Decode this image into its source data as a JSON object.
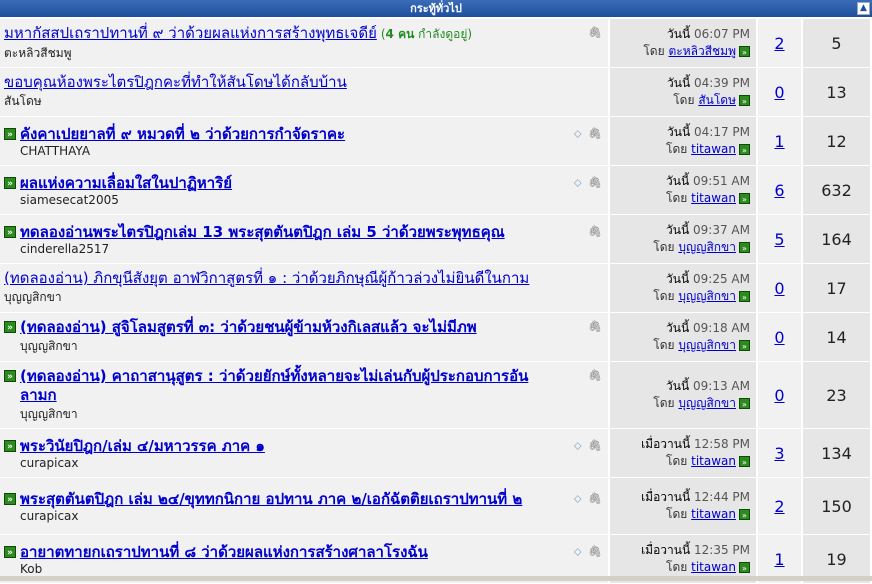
{
  "forum": {
    "header": "กระทู้ทั่วไป",
    "collapse_icon": "collapse-icon",
    "go_icon_label": "»",
    "threads": [
      {
        "title": "มหากัสสปเถราปทานที่ ๙ ว่าด้วยผลแห่งการสร้างพุทธเจดีย์",
        "viewing": "(",
        "viewing_count": "4 คน",
        "viewing_suffix": " กำลังดูอยู่)",
        "author": "ตะหลิวสีชมพู",
        "day": "วันนี้",
        "time": "06:07 PM",
        "by": "โดย",
        "last_poster": "ตะหลิวสีชมพู",
        "replies": "2",
        "views": "5",
        "bold": false,
        "go": false,
        "tag": false,
        "clip": true
      },
      {
        "title": "ขอบคุณห้องพระไตรปิฎกคะที่ทำให้สันโดษได้กลับบ้าน",
        "author": "สันโดษ",
        "day": "วันนี้",
        "time": "04:39 PM",
        "by": "โดย",
        "last_poster": "สันโดษ",
        "replies": "0",
        "views": "13",
        "bold": false,
        "go": false,
        "tag": false,
        "clip": false
      },
      {
        "title": "คังคาเปยยาลที่ ๙ หมวดที่ ๒ ว่าด้วยการกำจัดราคะ",
        "author": "CHATTHAYA",
        "day": "วันนี้",
        "time": "04:17 PM",
        "by": "โดย",
        "last_poster": "titawan",
        "replies": "1",
        "views": "12",
        "bold": true,
        "go": true,
        "tag": true,
        "clip": true
      },
      {
        "title": "ผลแห่งความเลื่อมใสในปาฏิหาริย์",
        "author": "siamesecat2005",
        "day": "วันนี้",
        "time": "09:51 AM",
        "by": "โดย",
        "last_poster": "titawan",
        "replies": "6",
        "views": "632",
        "bold": true,
        "go": true,
        "tag": true,
        "clip": true
      },
      {
        "title": "ทดลองอ่านพระไตรปิฎกเล่ม 13 พระสุตตันตปิฎก เล่ม 5 ว่าด้วยพระพุทธคุณ",
        "author": "cinderella2517",
        "day": "วันนี้",
        "time": "09:37 AM",
        "by": "โดย",
        "last_poster": "บุญญสิกขา",
        "replies": "5",
        "views": "164",
        "bold": true,
        "go": true,
        "tag": false,
        "clip": true
      },
      {
        "title": "(ทดลองอ่าน) ภิกขุนีสังยุต อาฬวิกาสูตรที่ ๑ : ว่าด้วยภิกษุณีผู้ก้าวล่วงไม่ยินดีในกาม",
        "author": "บุญญสิกขา",
        "day": "วันนี้",
        "time": "09:25 AM",
        "by": "โดย",
        "last_poster": "บุญญสิกขา",
        "replies": "0",
        "views": "17",
        "bold": false,
        "go": false,
        "tag": false,
        "clip": false
      },
      {
        "title": "(ทดลองอ่าน) สูจิโลมสูตรที่ ๓: ว่าด้วยชนผู้ข้ามห้วงกิเลสแล้ว จะไม่มีภพ",
        "author": "บุญญสิกขา",
        "day": "วันนี้",
        "time": "09:18 AM",
        "by": "โดย",
        "last_poster": "บุญญสิกขา",
        "replies": "0",
        "views": "14",
        "bold": true,
        "go": true,
        "tag": false,
        "clip": true
      },
      {
        "title": "(ทดลองอ่าน) คาถาสานุสูตร : ว่าด้วยยักษ์ทั้งหลายจะไม่เล่นกับผู้ประกอบการอันลามก",
        "author": "บุญญสิกขา",
        "day": "วันนี้",
        "time": "09:13 AM",
        "by": "โดย",
        "last_poster": "บุญญสิกขา",
        "replies": "0",
        "views": "23",
        "bold": true,
        "go": true,
        "tag": false,
        "clip": true
      },
      {
        "title": "พระวินัยปิฎก/เล่ม ๔/มหาวรรค ภาค ๑",
        "author": "curapicax",
        "day": "เมื่อวานนี้",
        "time": "12:58 PM",
        "by": "โดย",
        "last_poster": "titawan",
        "replies": "3",
        "views": "134",
        "bold": true,
        "go": true,
        "tag": true,
        "clip": true
      },
      {
        "title": "พระสุตตันตปิฎก เล่ม ๒๔/ขุททกนิกาย อปทาน ภาค ๒/เอกัฉัตติยเถราปทานที่ ๒",
        "author": "curapicax",
        "day": "เมื่อวานนี้",
        "time": "12:44 PM",
        "by": "โดย",
        "last_poster": "titawan",
        "replies": "2",
        "views": "150",
        "bold": true,
        "go": true,
        "tag": true,
        "clip": true
      },
      {
        "title": "อายาตทายกเถราปทานที่ ๘ ว่าด้วยผลแห่งการสร้างศาลาโรงฉัน",
        "author": "Kob",
        "day": "เมื่อวานนี้",
        "time": "12:35 PM",
        "by": "โดย",
        "last_poster": "titawan",
        "replies": "1",
        "views": "19",
        "bold": true,
        "go": true,
        "tag": true,
        "clip": true
      }
    ]
  }
}
